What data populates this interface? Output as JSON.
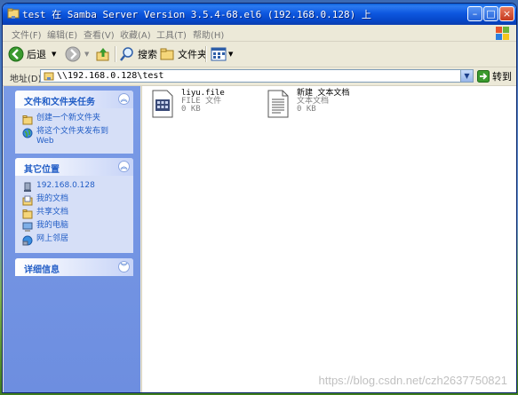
{
  "window": {
    "title": "test 在 Samba Server Version 3.5.4-68.el6 (192.168.0.128) 上",
    "controls": [
      "minimize",
      "maximize",
      "close"
    ]
  },
  "menu": [
    "文件(F)",
    "编辑(E)",
    "查看(V)",
    "收藏(A)",
    "工具(T)",
    "帮助(H)"
  ],
  "toolbar": {
    "back_label": "后退",
    "search_label": "搜索",
    "folders_label": "文件夹"
  },
  "address": {
    "label": "地址(D)",
    "value": "\\\\192.168.0.128\\test",
    "go_label": "转到"
  },
  "sidebar": {
    "tasks": {
      "title": "文件和文件夹任务",
      "items": [
        "创建一个新文件夹",
        "将这个文件夹发布到 Web"
      ]
    },
    "places": {
      "title": "其它位置",
      "items": [
        "192.168.0.128",
        "我的文档",
        "共享文档",
        "我的电脑",
        "网上邻居"
      ]
    },
    "details": {
      "title": "详细信息"
    }
  },
  "files": [
    {
      "name": "liyu.file",
      "type": "FILE 文件",
      "size": "0 KB",
      "icon": "generic-file-icon"
    },
    {
      "name": "新建 文本文档",
      "type": "文本文档",
      "size": "0 KB",
      "icon": "text-document-icon"
    }
  ],
  "watermark": "https://blog.csdn.net/czh2637750821",
  "colors": {
    "titlebar": "#0a5fd8",
    "sidebar": "#7a9be6",
    "panel": "#d6dff7",
    "link": "#215dc6"
  }
}
